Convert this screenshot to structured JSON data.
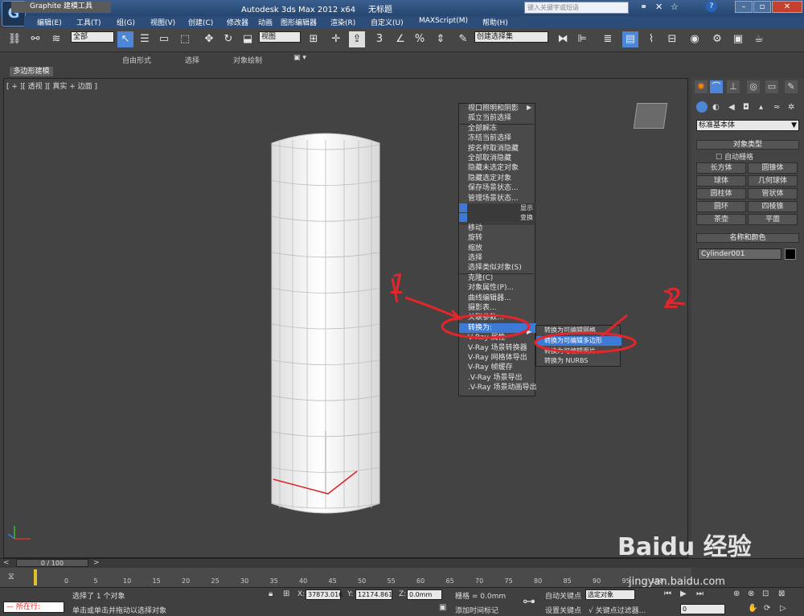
{
  "titlebar": {
    "app_title": "Autodesk 3ds Max  2012 x64",
    "file_name": "无标题",
    "search_placeholder": "键入关键字或短语",
    "workspace": ""
  },
  "menubar": {
    "items": [
      "编辑(E)",
      "工具(T)",
      "组(G)",
      "视图(V)",
      "创建(C)",
      "修改器",
      "动画",
      "图形编辑器",
      "渲染(R)",
      "自定义(U)",
      "MAXScript(M)",
      "帮助(H)"
    ]
  },
  "toolbar": {
    "selection_filter": "全部",
    "reference_coord": "视图",
    "named_selection": "创建选择集"
  },
  "ribbon": {
    "tabs": [
      "Graphite 建模工具",
      "自由形式",
      "选择",
      "对象绘制"
    ],
    "subtab": "多边形建模"
  },
  "viewport": {
    "label": "[ + ][ 透视 ][ 真实 + 边面 ]"
  },
  "quad_menu": {
    "items": [
      "视口照明和阴影",
      "孤立当前选择",
      "全部解冻",
      "冻结当前选择",
      "按名称取消隐藏",
      "全部取消隐藏",
      "隐藏未选定对象",
      "隐藏选定对象",
      "保存场景状态...",
      "管理场景状态...",
      "显示",
      "变换",
      "移动",
      "旋转",
      "缩放",
      "选择",
      "选择类似对象(S)",
      "克隆(C)",
      "对象属性(P)...",
      "曲线编辑器...",
      "摄影表...",
      "关联参数...",
      "转换为:",
      "V-Ray 属性",
      "V-Ray 场景转换器",
      "V-Ray 网格体导出",
      "V-Ray 帧缓存",
      ".V-Ray 场景导出",
      ".V-Ray 场景动画导出"
    ],
    "submenu": [
      "转换为可编辑网格",
      "转换为可编辑多边形",
      "转换为可编辑面片",
      "转换为 NURBS"
    ]
  },
  "command_panel": {
    "category": "标准基本体",
    "rollout_object_type": "对象类型",
    "autogrid": "自动栅格",
    "object_buttons": [
      "长方体",
      "圆锥体",
      "球体",
      "几何球体",
      "圆柱体",
      "管状体",
      "圆环",
      "四棱锥",
      "茶壶",
      "平面"
    ],
    "rollout_name_color": "名称和颜色",
    "object_name": "Cylinder001",
    "object_color": "#000000"
  },
  "timeline": {
    "frame_counter": "0 / 100",
    "ticks": [
      "0",
      "5",
      "10",
      "15",
      "20",
      "25",
      "30",
      "35",
      "40",
      "45",
      "50",
      "55",
      "60",
      "65",
      "70",
      "75",
      "80",
      "85",
      "90",
      "95",
      "100"
    ]
  },
  "status": {
    "mode_label": "所在行:",
    "selection_info": "选择了 1 个对象",
    "prompt": "单击或单击并拖动以选择对象",
    "x_label": "X:",
    "x_value": "37873.016",
    "y_label": "Y:",
    "y_value": "12174.861",
    "z_label": "Z:",
    "z_value": "0.0mm",
    "grid": "栅格 = 0.0mm",
    "add_time_tag": "添加时间标记",
    "auto_key": "自动关键点",
    "set_key": "设置关键点",
    "selected_obj": "选定对象",
    "key_filters": "关键点过滤器...",
    "frame": "0"
  },
  "annotations": {
    "mark_one": "1",
    "mark_two": "2"
  },
  "watermark": {
    "brand": "Baidu 经验",
    "url": "jingyan.baidu.com"
  },
  "colors": {
    "highlight": "#3c7ad6",
    "annotation": "#e3262b",
    "titlebar": "#2d4d78"
  }
}
